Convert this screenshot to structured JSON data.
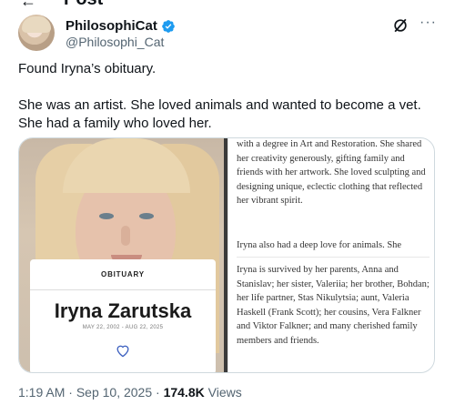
{
  "page": {
    "header_title": "Post"
  },
  "author": {
    "display_name": "PhilosophiCat",
    "handle": "@Philosophi_Cat",
    "verified_color": "#1d9bf0"
  },
  "tweet": {
    "line1": "Found Iryna’s obituary.",
    "line2": "She was an artist. She loved animals and wanted to become a vet. She had a family who loved her."
  },
  "obituary_card": {
    "label": "OBITUARY",
    "name": "Iryna Zarutska",
    "dates": "MAY 22, 2002 - AUG 22, 2025"
  },
  "obituary_text": {
    "p1_partial": "with a degree in Art and Restoration. She shared her creativity generously, gifting family and friends with her artwork. She loved sculpting and designing unique, eclectic clothing that reflected her vibrant spirit.",
    "p2": "Iryna also had a deep love for animals. She",
    "p3": "Iryna is survived by her parents, Anna and Stanislav; her sister, Valeriia; her brother, Bohdan; her life partner, Stas Nikulytsia; aunt, Valeria Haskell (Frank Scott); her cousins, Vera Falkner and Viktor Falkner; and many cherished family members and friends."
  },
  "meta": {
    "time": "1:19 AM",
    "sep1": " · ",
    "date": "Sep 10, 2025",
    "sep2": " · ",
    "views_count": "174.8K",
    "views_label": " Views"
  },
  "icons": {
    "back": "back-arrow-icon",
    "verified": "verified-badge-icon",
    "grok": "grok-icon",
    "more": "more-icon",
    "heart": "heart-icon"
  }
}
